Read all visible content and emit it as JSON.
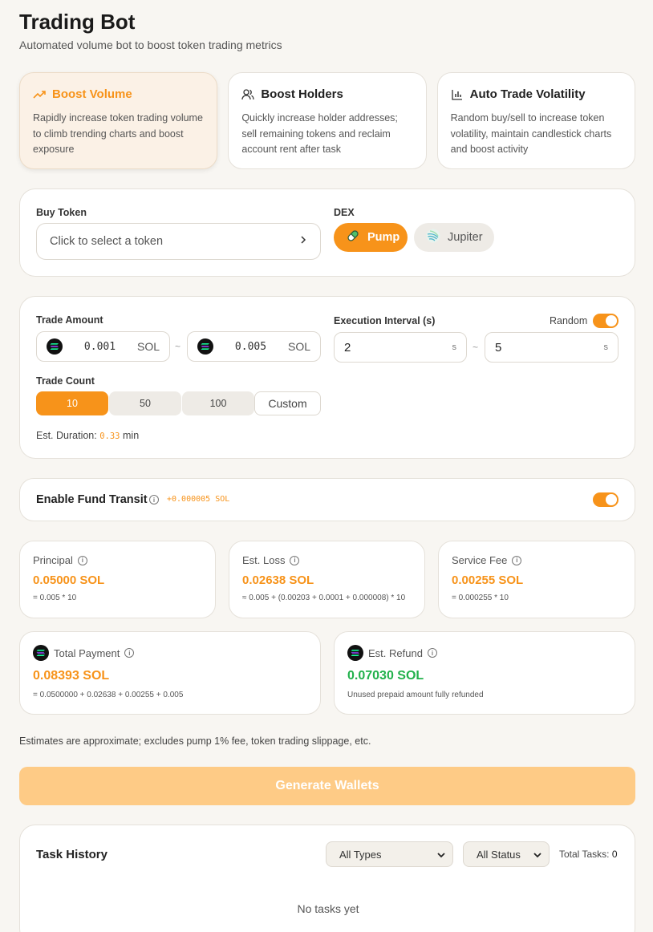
{
  "header": {
    "title": "Trading Bot",
    "subtitle": "Automated volume bot to boost token trading metrics"
  },
  "modes": [
    {
      "label": "Boost Volume",
      "desc": "Rapidly increase token trading volume to climb trending charts and boost exposure",
      "icon": "trending-up-icon",
      "active": true
    },
    {
      "label": "Boost Holders",
      "desc": "Quickly increase holder addresses; sell remaining tokens and reclaim account rent after task",
      "icon": "users-icon",
      "active": false
    },
    {
      "label": "Auto Trade Volatility",
      "desc": "Random buy/sell to increase token volatility, maintain candlestick charts and boost activity",
      "icon": "bar-chart-icon",
      "active": false
    }
  ],
  "token": {
    "label": "Buy Token",
    "placeholder": "Click to select a token"
  },
  "dex": {
    "label": "DEX",
    "options": [
      {
        "label": "Pump",
        "active": true
      },
      {
        "label": "Jupiter",
        "active": false
      }
    ]
  },
  "trade": {
    "amount_label": "Trade Amount",
    "min_amount": "0.001",
    "max_amount": "0.005",
    "unit": "SOL",
    "interval_label": "Execution Interval (s)",
    "random_label": "Random",
    "min_interval": "2",
    "max_interval": "5",
    "interval_unit": "s",
    "tilde": "~",
    "count_label": "Trade Count",
    "counts": [
      "10",
      "50",
      "100"
    ],
    "custom_label": "Custom",
    "duration_label": "Est. Duration:",
    "duration_value": "0.33",
    "duration_unit": "min"
  },
  "transit": {
    "label": "Enable Fund Transit",
    "fee": "+0.000005 SOL"
  },
  "stats": {
    "principal": {
      "label": "Principal",
      "value": "0.05000 SOL",
      "formula": "= 0.005 * 10"
    },
    "loss": {
      "label": "Est. Loss",
      "value": "0.02638 SOL",
      "formula": "≈ 0.005 + (0.00203 + 0.0001 + 0.000008) * 10"
    },
    "fee": {
      "label": "Service Fee",
      "value": "0.00255 SOL",
      "formula": "= 0.000255 * 10"
    },
    "total": {
      "label": "Total Payment",
      "value": "0.08393 SOL",
      "formula": "= 0.0500000 + 0.02638 + 0.00255 + 0.005"
    },
    "refund": {
      "label": "Est. Refund",
      "value": "0.07030 SOL",
      "formula": "Unused prepaid amount fully refunded"
    }
  },
  "note": "Estimates are approximate; excludes pump 1% fee, token trading slippage, etc.",
  "generate_label": "Generate Wallets",
  "history": {
    "title": "Task History",
    "type_filter": "All Types",
    "status_filter": "All Status",
    "total_label": "Total Tasks:",
    "total_value": "0",
    "empty": "No tasks yet"
  },
  "colors": {
    "accent": "#f7931a",
    "success": "#22b14c"
  }
}
